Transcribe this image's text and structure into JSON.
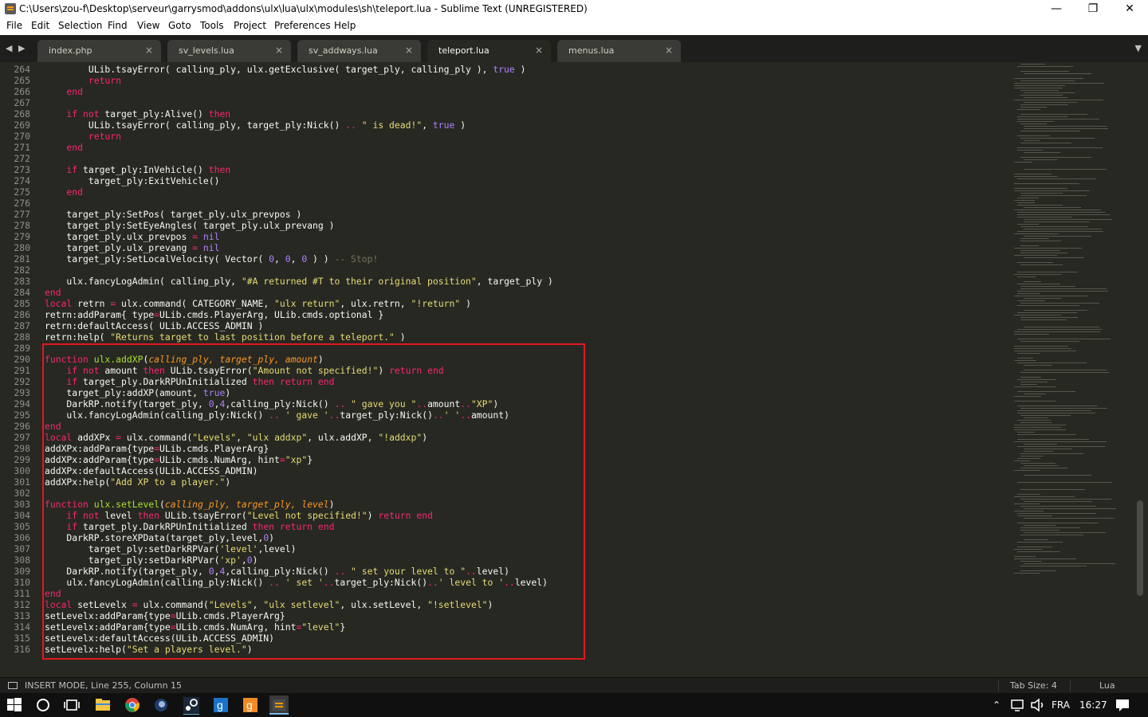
{
  "window": {
    "title": "C:\\Users\\zou-f\\Desktop\\serveur\\garrysmod\\addons\\ulx\\lua\\ulx\\modules\\sh\\teleport.lua - Sublime Text (UNREGISTERED)",
    "minimize": "—",
    "maximize": "❐",
    "close": "✕"
  },
  "menu": [
    "File",
    "Edit",
    "Selection",
    "Find",
    "View",
    "Goto",
    "Tools",
    "Project",
    "Preferences",
    "Help"
  ],
  "tabs": [
    {
      "label": "index.php",
      "active": false
    },
    {
      "label": "sv_levels.lua",
      "active": false
    },
    {
      "label": "sv_addways.lua",
      "active": false
    },
    {
      "label": "teleport.lua",
      "active": true
    },
    {
      "label": "menus.lua",
      "active": false
    }
  ],
  "tab_close": "×",
  "nav": {
    "back": "◀",
    "forward": "▶",
    "dropdown": "▼"
  },
  "code": {
    "line_numbers": [
      "264",
      "265",
      "266",
      "267",
      "268",
      "269",
      "270",
      "271",
      "272",
      "273",
      "274",
      "275",
      "276",
      "277",
      "278",
      "279",
      "280",
      "281",
      "282",
      "283",
      "284",
      "285",
      "286",
      "287",
      "288",
      "289",
      "290",
      "291",
      "292",
      "293",
      "294",
      "295",
      "296",
      "297",
      "298",
      "299",
      "300",
      "301",
      "302",
      "303",
      "304",
      "305",
      "306",
      "307",
      "308",
      "309",
      "310",
      "311",
      "312",
      "313",
      "314",
      "315",
      "316"
    ],
    "lines": [
      [
        [
          "x",
          "        ULib.tsayError( calling_ply, ulx.getExclusive( target_ply, calling_ply ), "
        ],
        [
          "n",
          "true"
        ],
        [
          "x",
          " )"
        ]
      ],
      [
        [
          "k",
          "        return"
        ]
      ],
      [
        [
          "k",
          "    end"
        ]
      ],
      [
        [
          "x",
          ""
        ]
      ],
      [
        [
          "k",
          "    if not"
        ],
        [
          "x",
          " target_ply:Alive() "
        ],
        [
          "k",
          "then"
        ]
      ],
      [
        [
          "x",
          "        ULib.tsayError( calling_ply, target_ply:Nick() "
        ],
        [
          "k",
          ".."
        ],
        [
          "s",
          " \" is dead!\""
        ],
        [
          "x",
          ", "
        ],
        [
          "n",
          "true"
        ],
        [
          "x",
          " )"
        ]
      ],
      [
        [
          "k",
          "        return"
        ]
      ],
      [
        [
          "k",
          "    end"
        ]
      ],
      [
        [
          "x",
          ""
        ]
      ],
      [
        [
          "k",
          "    if"
        ],
        [
          "x",
          " target_ply:InVehicle() "
        ],
        [
          "k",
          "then"
        ]
      ],
      [
        [
          "x",
          "        target_ply:ExitVehicle()"
        ]
      ],
      [
        [
          "k",
          "    end"
        ]
      ],
      [
        [
          "x",
          ""
        ]
      ],
      [
        [
          "x",
          "    target_ply:SetPos( target_ply.ulx_prevpos )"
        ]
      ],
      [
        [
          "x",
          "    target_ply:SetEyeAngles( target_ply.ulx_prevang )"
        ]
      ],
      [
        [
          "x",
          "    target_ply.ulx_prevpos "
        ],
        [
          "k",
          "="
        ],
        [
          "x",
          " "
        ],
        [
          "n",
          "nil"
        ]
      ],
      [
        [
          "x",
          "    target_ply.ulx_prevang "
        ],
        [
          "k",
          "="
        ],
        [
          "x",
          " "
        ],
        [
          "n",
          "nil"
        ]
      ],
      [
        [
          "x",
          "    target_ply:SetLocalVelocity( Vector( "
        ],
        [
          "n",
          "0"
        ],
        [
          "x",
          ", "
        ],
        [
          "n",
          "0"
        ],
        [
          "x",
          ", "
        ],
        [
          "n",
          "0"
        ],
        [
          "x",
          " ) ) "
        ],
        [
          "c",
          "-- Stop!"
        ]
      ],
      [
        [
          "x",
          ""
        ]
      ],
      [
        [
          "x",
          "    ulx.fancyLogAdmin( calling_ply, "
        ],
        [
          "s",
          "\"#A returned #T to their original position\""
        ],
        [
          "x",
          ", target_ply )"
        ]
      ],
      [
        [
          "k",
          "end"
        ]
      ],
      [
        [
          "k",
          "local"
        ],
        [
          "x",
          " retrn "
        ],
        [
          "k",
          "="
        ],
        [
          "x",
          " ulx.command( CATEGORY_NAME, "
        ],
        [
          "s",
          "\"ulx return\""
        ],
        [
          "x",
          ", ulx.retrn, "
        ],
        [
          "s",
          "\"!return\""
        ],
        [
          "x",
          " )"
        ]
      ],
      [
        [
          "x",
          "retrn:addParam{ type"
        ],
        [
          "k",
          "="
        ],
        [
          "x",
          "ULib.cmds.PlayerArg, ULib.cmds.optional }"
        ]
      ],
      [
        [
          "x",
          "retrn:defaultAccess( ULib.ACCESS_ADMIN )"
        ]
      ],
      [
        [
          "x",
          "retrn:help( "
        ],
        [
          "s",
          "\"Returns target to last position before a teleport.\""
        ],
        [
          "x",
          " )"
        ]
      ],
      [
        [
          "x",
          ""
        ]
      ],
      [
        [
          "k",
          "function"
        ],
        [
          "x",
          " "
        ],
        [
          "f",
          "ulx.addXP"
        ],
        [
          "x",
          "("
        ],
        [
          "p",
          "calling_ply, target_ply, amount"
        ],
        [
          "x",
          ")"
        ]
      ],
      [
        [
          "k",
          "    if not"
        ],
        [
          "x",
          " amount "
        ],
        [
          "k",
          "then"
        ],
        [
          "x",
          " ULib.tsayError("
        ],
        [
          "s",
          "\"Amount not specified!\""
        ],
        [
          "x",
          ") "
        ],
        [
          "k",
          "return end"
        ]
      ],
      [
        [
          "k",
          "    if"
        ],
        [
          "x",
          " target_ply.DarkRPUnInitialized "
        ],
        [
          "k",
          "then return end"
        ]
      ],
      [
        [
          "x",
          "    target_ply:addXP(amount, "
        ],
        [
          "n",
          "true"
        ],
        [
          "x",
          ")"
        ]
      ],
      [
        [
          "x",
          "    DarkRP.notify(target_ply, "
        ],
        [
          "n",
          "0"
        ],
        [
          "x",
          ","
        ],
        [
          "n",
          "4"
        ],
        [
          "x",
          ",calling_ply:Nick() "
        ],
        [
          "k",
          ".."
        ],
        [
          "s",
          " \" gave you \""
        ],
        [
          "k",
          ".."
        ],
        [
          "x",
          "amount"
        ],
        [
          "k",
          ".."
        ],
        [
          "s",
          "\"XP\""
        ],
        [
          "x",
          ")"
        ]
      ],
      [
        [
          "x",
          "    ulx.fancyLogAdmin(calling_ply:Nick() "
        ],
        [
          "k",
          ".."
        ],
        [
          "s",
          " ' gave '"
        ],
        [
          "k",
          ".."
        ],
        [
          "x",
          "target_ply:Nick()"
        ],
        [
          "k",
          ".."
        ],
        [
          "s",
          "' '"
        ],
        [
          "k",
          ".."
        ],
        [
          "x",
          "amount)"
        ]
      ],
      [
        [
          "k",
          "end"
        ]
      ],
      [
        [
          "k",
          "local"
        ],
        [
          "x",
          " addXPx "
        ],
        [
          "k",
          "="
        ],
        [
          "x",
          " ulx.command("
        ],
        [
          "s",
          "\"Levels\""
        ],
        [
          "x",
          ", "
        ],
        [
          "s",
          "\"ulx addxp\""
        ],
        [
          "x",
          ", ulx.addXP, "
        ],
        [
          "s",
          "\"!addxp\""
        ],
        [
          "x",
          ")"
        ]
      ],
      [
        [
          "x",
          "addXPx:addParam{type"
        ],
        [
          "k",
          "="
        ],
        [
          "x",
          "ULib.cmds.PlayerArg}"
        ]
      ],
      [
        [
          "x",
          "addXPx:addParam{type"
        ],
        [
          "k",
          "="
        ],
        [
          "x",
          "ULib.cmds.NumArg, hint"
        ],
        [
          "k",
          "="
        ],
        [
          "s",
          "\"xp\""
        ],
        [
          "x",
          "}"
        ]
      ],
      [
        [
          "x",
          "addXPx:defaultAccess(ULib.ACCESS_ADMIN)"
        ]
      ],
      [
        [
          "x",
          "addXPx:help("
        ],
        [
          "s",
          "\"Add XP to a player.\""
        ],
        [
          "x",
          ")"
        ]
      ],
      [
        [
          "x",
          ""
        ]
      ],
      [
        [
          "k",
          "function"
        ],
        [
          "x",
          " "
        ],
        [
          "f",
          "ulx.setLevel"
        ],
        [
          "x",
          "("
        ],
        [
          "p",
          "calling_ply, target_ply, level"
        ],
        [
          "x",
          ")"
        ]
      ],
      [
        [
          "k",
          "    if not"
        ],
        [
          "x",
          " level "
        ],
        [
          "k",
          "then"
        ],
        [
          "x",
          " ULib.tsayError("
        ],
        [
          "s",
          "\"Level not specified!\""
        ],
        [
          "x",
          ") "
        ],
        [
          "k",
          "return end"
        ]
      ],
      [
        [
          "k",
          "    if"
        ],
        [
          "x",
          " target_ply.DarkRPUnInitialized "
        ],
        [
          "k",
          "then return end"
        ]
      ],
      [
        [
          "x",
          "    DarkRP.storeXPData(target_ply,level,"
        ],
        [
          "n",
          "0"
        ],
        [
          "x",
          ")"
        ]
      ],
      [
        [
          "x",
          "        target_ply:setDarkRPVar("
        ],
        [
          "s",
          "'level'"
        ],
        [
          "x",
          ",level)"
        ]
      ],
      [
        [
          "x",
          "        target_ply:setDarkRPVar("
        ],
        [
          "s",
          "'xp'"
        ],
        [
          "x",
          ","
        ],
        [
          "n",
          "0"
        ],
        [
          "x",
          ")"
        ]
      ],
      [
        [
          "x",
          "    DarkRP.notify(target_ply, "
        ],
        [
          "n",
          "0"
        ],
        [
          "x",
          ","
        ],
        [
          "n",
          "4"
        ],
        [
          "x",
          ",calling_ply:Nick() "
        ],
        [
          "k",
          ".."
        ],
        [
          "s",
          " \" set your level to \""
        ],
        [
          "k",
          ".."
        ],
        [
          "x",
          "level)"
        ]
      ],
      [
        [
          "x",
          "    ulx.fancyLogAdmin(calling_ply:Nick() "
        ],
        [
          "k",
          ".."
        ],
        [
          "s",
          " ' set '"
        ],
        [
          "k",
          ".."
        ],
        [
          "x",
          "target_ply:Nick()"
        ],
        [
          "k",
          ".."
        ],
        [
          "s",
          "' level to '"
        ],
        [
          "k",
          ".."
        ],
        [
          "x",
          "level)"
        ]
      ],
      [
        [
          "k",
          "end"
        ]
      ],
      [
        [
          "k",
          "local"
        ],
        [
          "x",
          " setLevelx "
        ],
        [
          "k",
          "="
        ],
        [
          "x",
          " ulx.command("
        ],
        [
          "s",
          "\"Levels\""
        ],
        [
          "x",
          ", "
        ],
        [
          "s",
          "\"ulx setlevel\""
        ],
        [
          "x",
          ", ulx.setLevel, "
        ],
        [
          "s",
          "\"!setlevel\""
        ],
        [
          "x",
          ")"
        ]
      ],
      [
        [
          "x",
          "setLevelx:addParam{type"
        ],
        [
          "k",
          "="
        ],
        [
          "x",
          "ULib.cmds.PlayerArg}"
        ]
      ],
      [
        [
          "x",
          "setLevelx:addParam{type"
        ],
        [
          "k",
          "="
        ],
        [
          "x",
          "ULib.cmds.NumArg, hint"
        ],
        [
          "k",
          "="
        ],
        [
          "s",
          "\"level\""
        ],
        [
          "x",
          "}"
        ]
      ],
      [
        [
          "x",
          "setLevelx:defaultAccess(ULib.ACCESS_ADMIN)"
        ]
      ],
      [
        [
          "x",
          "setLevelx:help("
        ],
        [
          "s",
          "\"Set a players level.\""
        ],
        [
          "x",
          ")"
        ]
      ]
    ]
  },
  "status": {
    "mode": "INSERT MODE, Line 255, Column 15",
    "tab_size": "Tab Size: 4",
    "syntax": "Lua"
  },
  "taskbar": {
    "lang": "FRA",
    "time": "16:27"
  },
  "colors": {
    "keyword": "#f92672",
    "string": "#e6db74",
    "number": "#ae81ff",
    "function": "#a6e22e",
    "param": "#fd971f",
    "comment": "#75715e",
    "highlight_box": "#e0181f"
  }
}
